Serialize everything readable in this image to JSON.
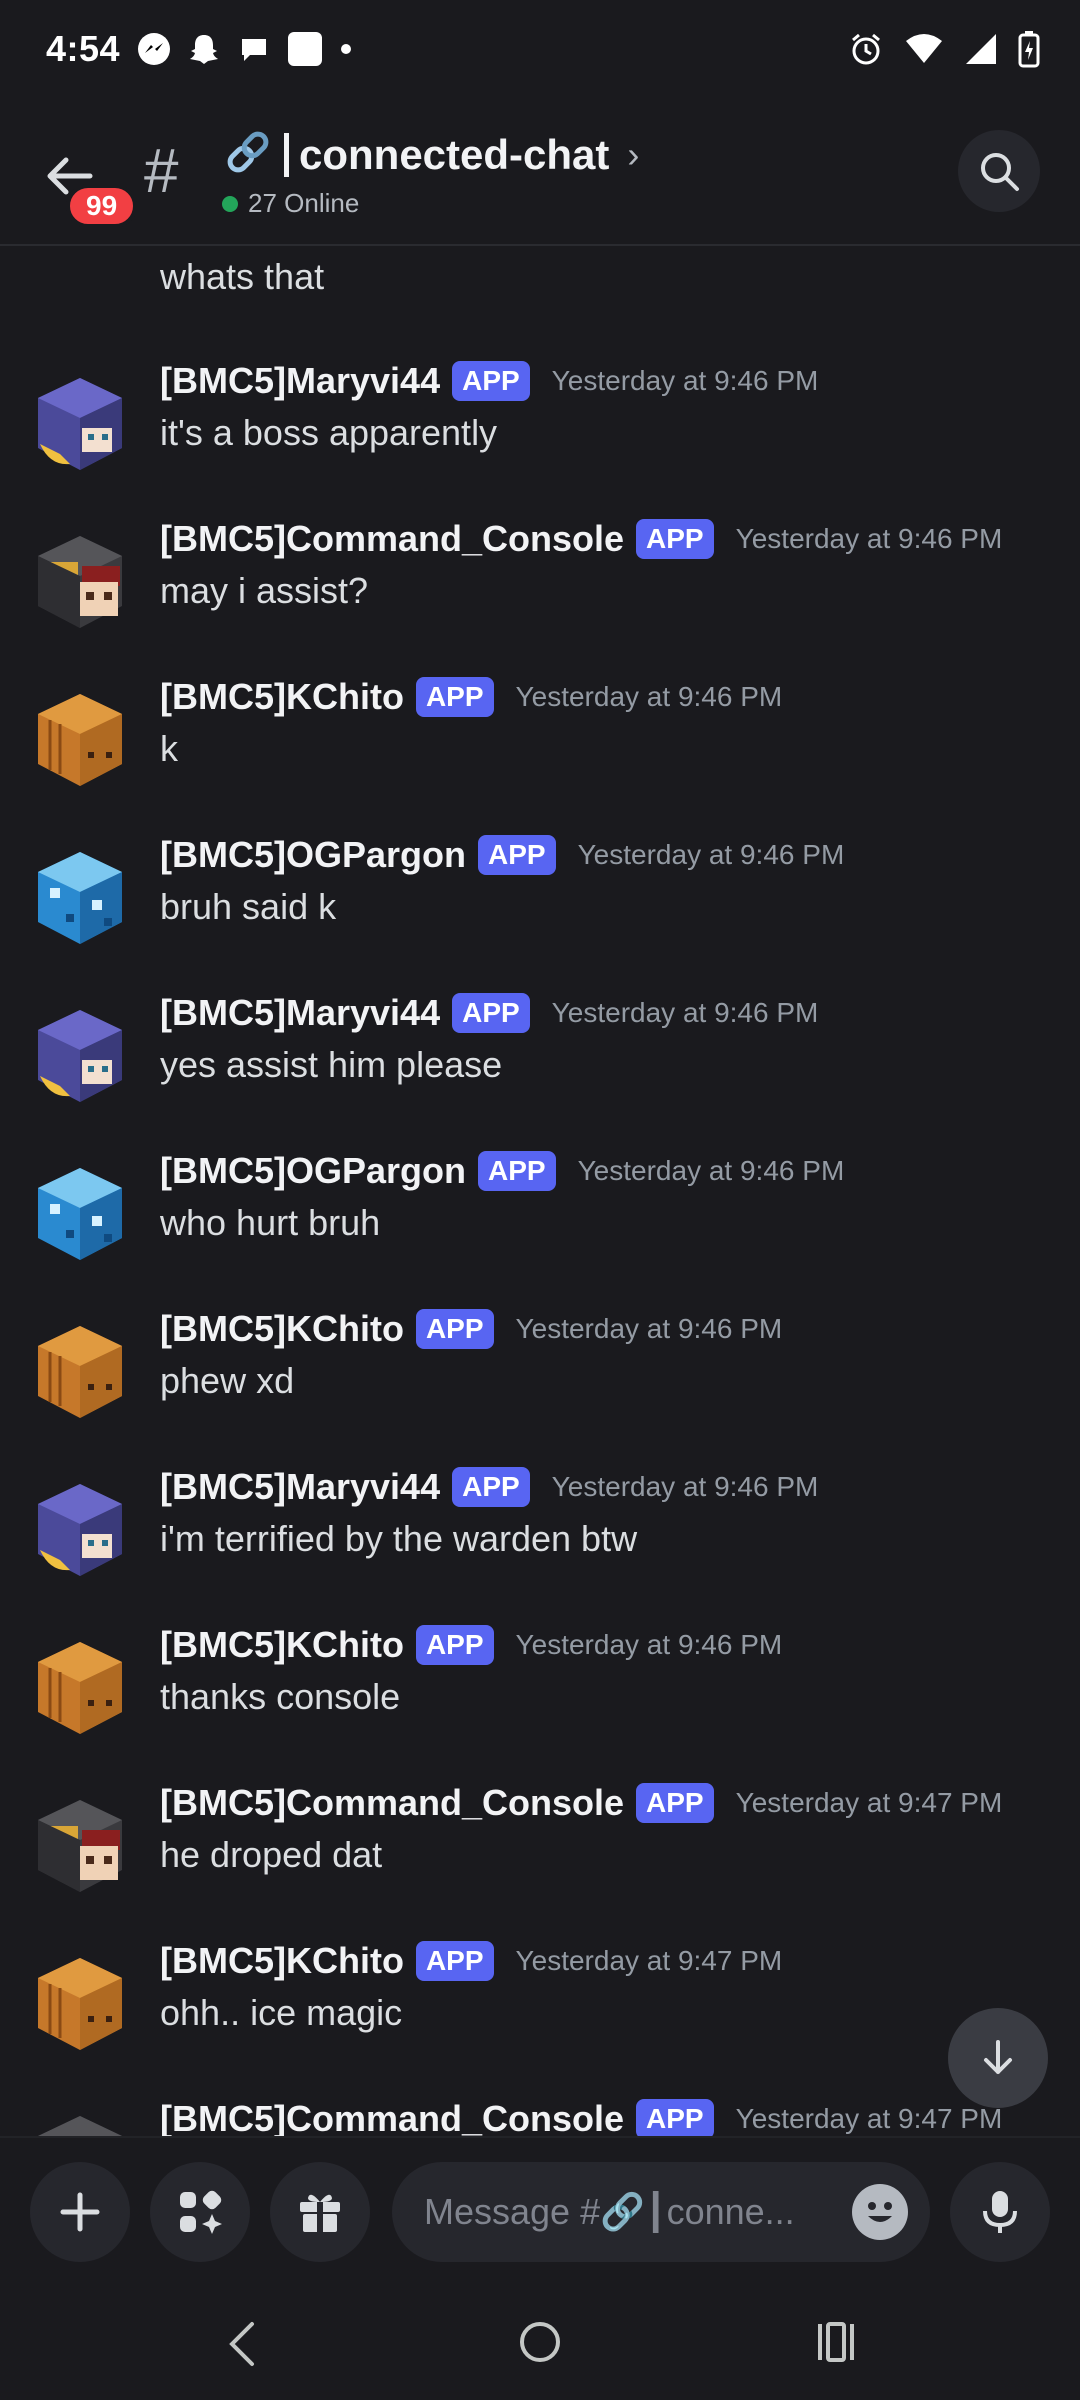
{
  "status_bar": {
    "time": "4:54"
  },
  "header": {
    "badge": "99",
    "hash": "#",
    "channel_name": "connected-chat",
    "online": "27 Online"
  },
  "messages": [
    {
      "text": "whats that",
      "continuation": true
    },
    {
      "user": "[BMC5]Maryvi44",
      "tag": "APP",
      "time": "Yesterday at 9:46 PM",
      "text": "it's a boss apparently",
      "avatar": "maryvi"
    },
    {
      "user": "[BMC5]Command_Console",
      "tag": "APP",
      "time": "Yesterday at 9:46 PM",
      "text": "may i assist?",
      "avatar": "console"
    },
    {
      "user": "[BMC5]KChito",
      "tag": "APP",
      "time": "Yesterday at 9:46 PM",
      "text": "k",
      "avatar": "kchito"
    },
    {
      "user": "[BMC5]OGPargon",
      "tag": "APP",
      "time": "Yesterday at 9:46 PM",
      "text": "bruh said k",
      "avatar": "ogpargon"
    },
    {
      "user": "[BMC5]Maryvi44",
      "tag": "APP",
      "time": "Yesterday at 9:46 PM",
      "text": "yes assist him please",
      "avatar": "maryvi"
    },
    {
      "user": "[BMC5]OGPargon",
      "tag": "APP",
      "time": "Yesterday at 9:46 PM",
      "text": "who hurt bruh",
      "avatar": "ogpargon"
    },
    {
      "user": "[BMC5]KChito",
      "tag": "APP",
      "time": "Yesterday at 9:46 PM",
      "text": "phew xd",
      "avatar": "kchito"
    },
    {
      "user": "[BMC5]Maryvi44",
      "tag": "APP",
      "time": "Yesterday at 9:46 PM",
      "text": "i'm terrified by the warden btw",
      "avatar": "maryvi"
    },
    {
      "user": "[BMC5]KChito",
      "tag": "APP",
      "time": "Yesterday at 9:46 PM",
      "text": "thanks console",
      "avatar": "kchito"
    },
    {
      "user": "[BMC5]Command_Console",
      "tag": "APP",
      "time": "Yesterday at 9:47 PM",
      "text": "he droped dat",
      "avatar": "console"
    },
    {
      "user": "[BMC5]KChito",
      "tag": "APP",
      "time": "Yesterday at 9:47 PM",
      "text": "ohh.. ice magic",
      "avatar": "kchito"
    },
    {
      "user": "[BMC5]Command_Console",
      "tag": "APP",
      "time": "Yesterday at 9:47 PM",
      "text": "",
      "avatar": "console"
    }
  ],
  "composer": {
    "placeholder": "Message #🔗┃conne..."
  },
  "icons": {
    "back": "arrow-left-icon",
    "search": "search-icon",
    "add": "plus-icon",
    "apps": "apps-icon",
    "gift": "gift-icon",
    "emoji": "emoji-icon",
    "mic": "microphone-icon",
    "scroll_down": "arrow-down-icon",
    "link": "link-icon"
  },
  "colors": {
    "background": "#1a1a1e",
    "app_tag": "#5865f2",
    "badge": "#f23f43",
    "online": "#23a55a",
    "timestamp": "#949ba4"
  }
}
